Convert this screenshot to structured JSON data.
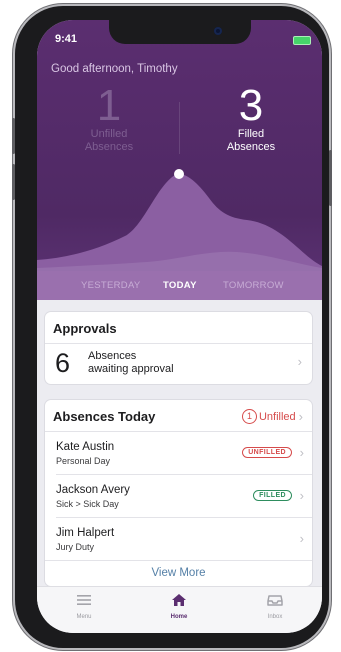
{
  "status": {
    "time": "9:41"
  },
  "greeting": "Good afternoon,  Timothy",
  "stats": {
    "unfilled": {
      "value": "1",
      "label_line1": "Unfilled",
      "label_line2": "Absences"
    },
    "filled": {
      "value": "3",
      "label_line1": "Filled",
      "label_line2": "Absences"
    }
  },
  "day_tabs": [
    {
      "label": "YESTERDAY"
    },
    {
      "label": "TODAY"
    },
    {
      "label": "TOMORROW"
    }
  ],
  "approvals": {
    "title": "Approvals",
    "count": "6",
    "text_line1": "Absences",
    "text_line2": "awaiting approval"
  },
  "absences": {
    "title": "Absences Today",
    "unfilled_count": "1",
    "unfilled_label": "Unfilled",
    "rows": [
      {
        "name": "Kate Austin",
        "reason": "Personal Day",
        "badge": "UNFILLED"
      },
      {
        "name": "Jackson Avery",
        "reason": "Sick > Sick Day",
        "badge": "FILLED"
      },
      {
        "name": "Jim Halpert",
        "reason": "Jury Duty",
        "badge": ""
      }
    ],
    "view_more": "View More"
  },
  "tabbar": [
    {
      "label": "Menu",
      "icon": "menu-icon"
    },
    {
      "label": "Home",
      "icon": "home-icon"
    },
    {
      "label": "Inbox",
      "icon": "inbox-icon"
    }
  ],
  "colors": {
    "brand_purple": "#5b2e70",
    "unfilled_red": "#d64b4b",
    "filled_green": "#2e8d5e",
    "link_blue": "#5580a7"
  }
}
